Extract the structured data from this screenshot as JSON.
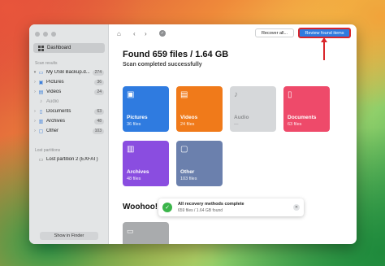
{
  "sidebar": {
    "dashboard_label": "Dashboard",
    "scan_results_label": "Scan results",
    "items": [
      {
        "label": "My USB Backup.d...",
        "count": "274",
        "icon": "drive-icon"
      },
      {
        "label": "Pictures",
        "count": "36",
        "icon": "pictures-icon"
      },
      {
        "label": "Videos",
        "count": "24",
        "icon": "videos-icon"
      },
      {
        "label": "Audio",
        "count": "",
        "icon": "audio-icon"
      },
      {
        "label": "Documents",
        "count": "63",
        "icon": "documents-icon"
      },
      {
        "label": "Archives",
        "count": "48",
        "icon": "archives-icon"
      },
      {
        "label": "Other",
        "count": "103",
        "icon": "other-icon"
      }
    ],
    "lost_partitions_label": "Lost partitions",
    "lost_partition": {
      "label": "Lost partition 2 (EXFAT)",
      "icon": "drive-icon"
    },
    "show_in_finder_label": "Show in Finder"
  },
  "toolbar": {
    "recover_all_label": "Recover all...",
    "review_label": "Review found items"
  },
  "main": {
    "title": "Found 659 files / 1.64 GB",
    "subtitle": "Scan completed successfully",
    "tiles": [
      {
        "name": "Pictures",
        "count": "36 files",
        "color": "#2f7be0",
        "icon": "pictures-icon"
      },
      {
        "name": "Videos",
        "count": "24 files",
        "color": "#f07a1a",
        "icon": "videos-icon"
      },
      {
        "name": "Audio",
        "count": "—",
        "color": "#d6d8da",
        "icon": "audio-icon"
      },
      {
        "name": "Documents",
        "count": "63 files",
        "color": "#ee4a6a",
        "icon": "documents-icon"
      },
      {
        "name": "Archives",
        "count": "48 files",
        "color": "#8a4de0",
        "icon": "archives-icon"
      },
      {
        "name": "Other",
        "count": "103 files",
        "color": "#6b80ad",
        "icon": "other-icon"
      }
    ],
    "woohoo": "Woohoo!"
  },
  "toast": {
    "title": "All recovery methods complete",
    "subtitle": "659 files / 1.64 GB found"
  },
  "colors": {
    "accent": "#2f7be0",
    "highlight": "#d9262b",
    "success": "#3bb54a"
  }
}
